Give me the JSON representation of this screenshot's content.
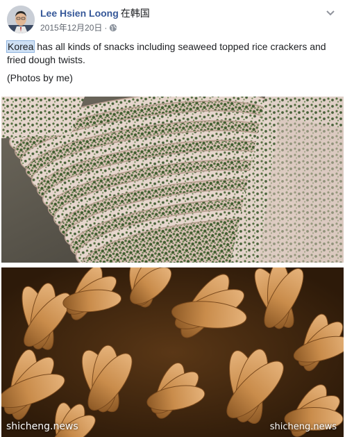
{
  "post": {
    "author_name": "Lee Hsien Loong",
    "location": "在韩国",
    "date": "2015年12月20日",
    "separator": "·",
    "privacy_icon": "globe-icon",
    "menu_icon": "chevron-down-icon",
    "text_highlight": "Korea",
    "text_rest": " has all kinds of snacks including seaweed topped rice crackers and fried dough twists.",
    "text_credit": "(Photos by me)"
  },
  "photos": [
    {
      "subject": "seaweed topped rice crackers"
    },
    {
      "subject": "fried dough twists"
    }
  ],
  "watermark": {
    "left": "shicheng.news",
    "right": "shicheng.news"
  },
  "colors": {
    "author_link": "#365899",
    "highlight": "#cfe1f5",
    "meta_text": "#616770"
  }
}
